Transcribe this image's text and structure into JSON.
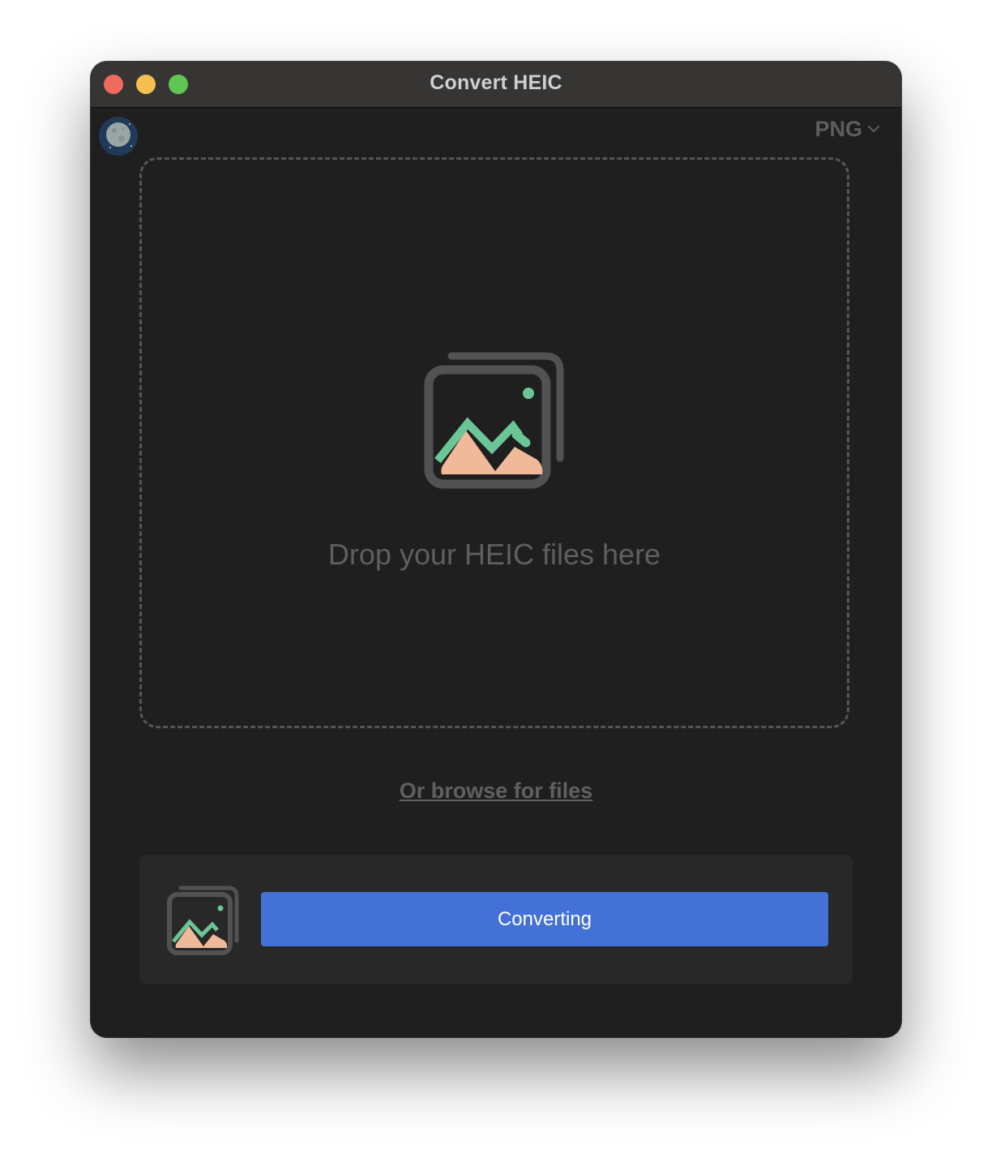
{
  "window": {
    "title": "Convert HEIC"
  },
  "toolbar": {
    "format_value": "PNG",
    "format_icon": "chevron-down-icon",
    "avatar_icon": "moon-icon"
  },
  "dropzone": {
    "icon": "image-stack-icon",
    "text": "Drop your HEIC files here"
  },
  "browse": {
    "label": "Or browse for files"
  },
  "action": {
    "thumbnail_icon": "image-stack-icon",
    "button_label": "Converting",
    "button_color": "#4471d6"
  },
  "colors": {
    "background": "#1f1f1f",
    "titlebar": "#363534",
    "traffic_close": "#ec6a5e",
    "traffic_minimize": "#f4bf4f",
    "traffic_maximize": "#61c554",
    "icon_green": "#6cc596",
    "icon_peach": "#f0b99a"
  }
}
